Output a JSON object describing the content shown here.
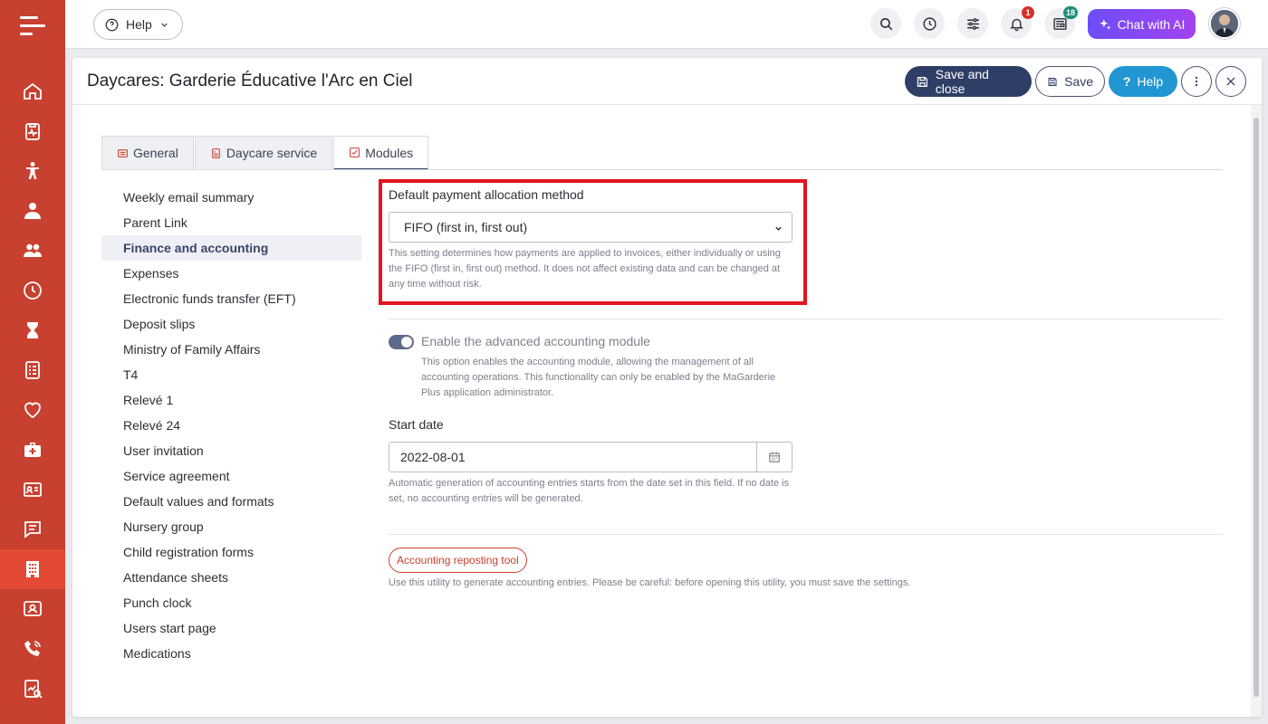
{
  "topbar": {
    "help_label": "Help",
    "notifications_count": "1",
    "news_count": "18",
    "chat_ai_label": "Chat with AI"
  },
  "panel": {
    "title": "Daycares: Garderie Éducative l'Arc en Ciel",
    "save_close_label": "Save and close",
    "save_label": "Save",
    "help_label": "Help"
  },
  "tabs": [
    {
      "label": "General",
      "icon": "list-icon"
    },
    {
      "label": "Daycare service",
      "icon": "document-icon"
    },
    {
      "label": "Modules",
      "icon": "checkbox-icon"
    }
  ],
  "side_menu": [
    "Weekly email summary",
    "Parent Link",
    "Finance and accounting",
    "Expenses",
    "Electronic funds transfer (EFT)",
    "Deposit slips",
    "Ministry of Family Affairs",
    "T4",
    "Relevé 1",
    "Relevé 24",
    "User invitation",
    "Service agreement",
    "Default values and formats",
    "Nursery group",
    "Child registration forms",
    "Attendance sheets",
    "Punch clock",
    "Users start page",
    "Medications"
  ],
  "finance": {
    "payment_method_label": "Default payment allocation method",
    "payment_method_value": "FIFO (first in, first out)",
    "payment_method_help": "This setting determines how payments are applied to invoices, either individually or using the FIFO (first in, first out) method. It does not affect existing data and can be changed at any time without risk.",
    "advanced_label": "Enable the advanced accounting module",
    "advanced_help": "This option enables the accounting module, allowing the management of all accounting operations. This functionality can only be enabled by the MaGarderie Plus application administrator.",
    "start_date_label": "Start date",
    "start_date_value": "2022-08-01",
    "start_date_help": "Automatic generation of accounting entries starts from the date set in this field. If no date is set, no accounting entries will be generated.",
    "repost_label": "Accounting reposting tool",
    "repost_help": "Use this utility to generate accounting entries. Please be careful: before opening this utility, you must save the settings."
  },
  "colors": {
    "rail": "#c8402f",
    "primary_dark": "#2f3e66",
    "help_blue": "#2196d3",
    "highlight": "#e0161e"
  }
}
